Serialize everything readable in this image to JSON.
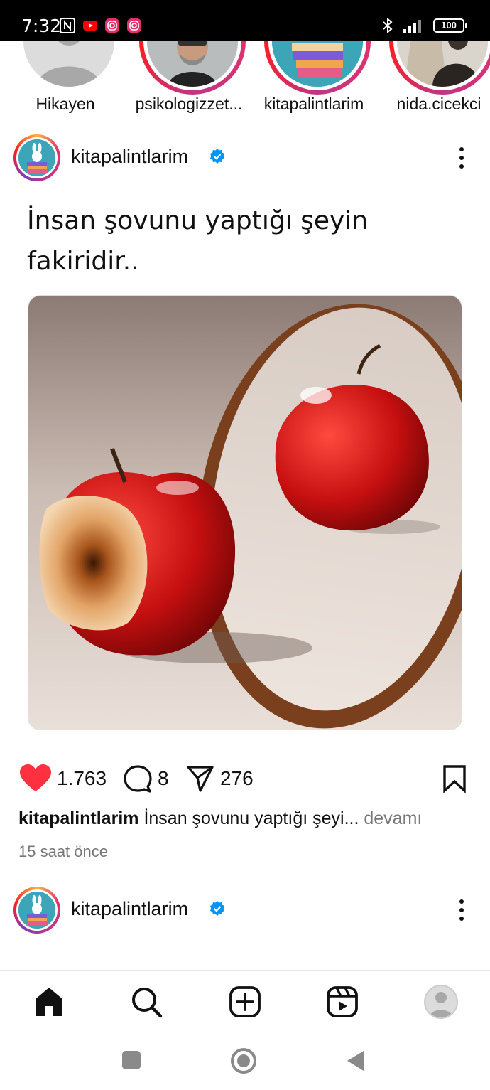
{
  "status_bar": {
    "time": "7:32",
    "battery": "100"
  },
  "stories": [
    {
      "label": "Hikayen",
      "is_own": true
    },
    {
      "label": "psikologizzet..."
    },
    {
      "label": "kitapalintlarim"
    },
    {
      "label": "nida.cicekci"
    }
  ],
  "post1": {
    "username": "kitapalintlarim",
    "verified": true,
    "text": "İnsan şovunu yaptığı şeyin fakiridir..",
    "likes": "1.763",
    "comments": "8",
    "shares": "276",
    "caption_user": "kitapalintlarim",
    "caption_snippet": "İnsan şovunu yaptığı şeyi...",
    "more_label": "devamı",
    "time_ago": "15 saat önce"
  },
  "post2": {
    "username": "kitapalintlarim",
    "verified": true
  },
  "colors": {
    "like_red": "#ff3040",
    "verified_blue": "#0095f6",
    "ring_gradient_start": "#fcaf45",
    "ring_gradient_end": "#c13584"
  },
  "icons": {
    "nav": [
      "home-icon",
      "search-icon",
      "create-icon",
      "reels-icon",
      "profile-icon"
    ],
    "system": [
      "recents-icon",
      "home-circle-icon",
      "back-icon"
    ]
  }
}
